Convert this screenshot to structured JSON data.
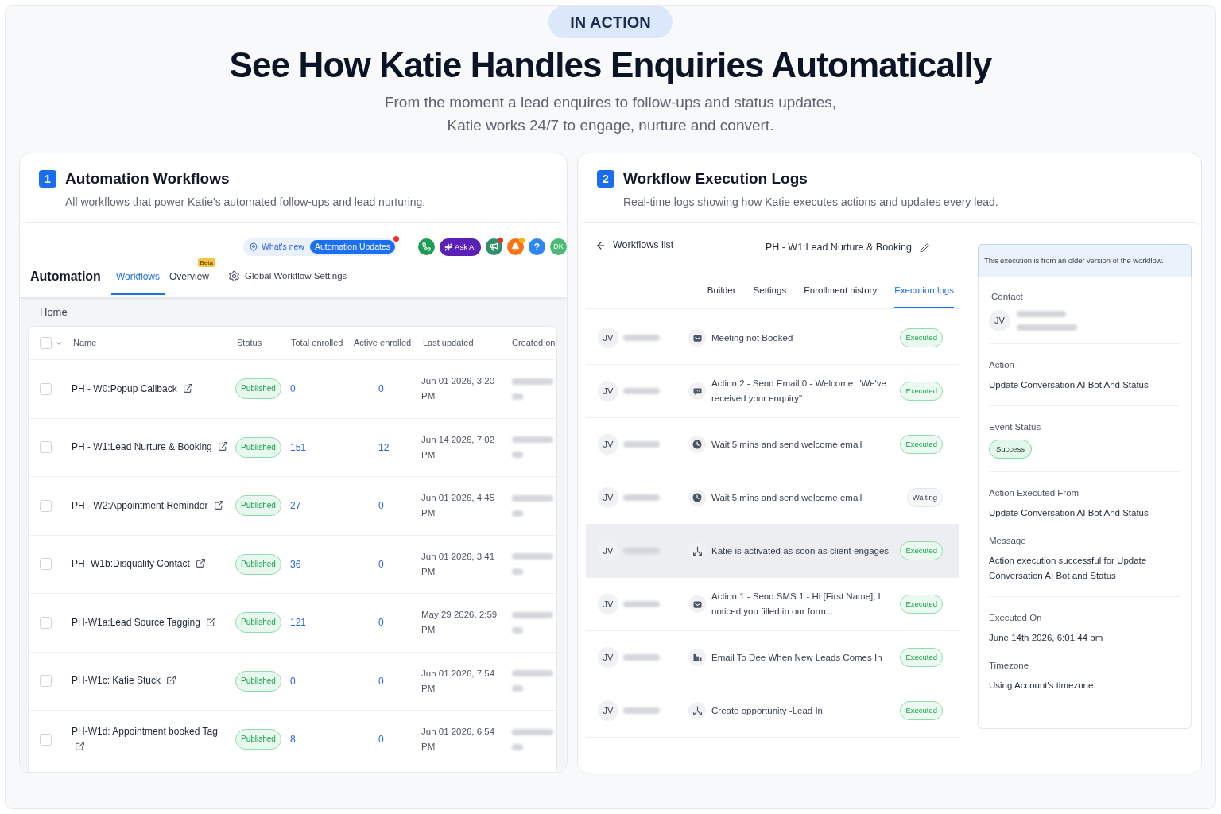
{
  "hero": {
    "badge": "IN ACTION",
    "title": "See How Katie Handles Enquiries Automatically",
    "subtitle_lines": [
      "From the moment a lead enquires to follow-ups and status updates,",
      "Katie works 24/7 to engage, nurture and convert."
    ]
  },
  "workflows_card": {
    "number": "1",
    "title": "Automation Workflows",
    "description": "All workflows that power Katie's automated follow-ups and lead nurturing.",
    "toolbar": {
      "whats_new": "What's new",
      "update_tag": "Automation Updates",
      "update_alert": true,
      "buttons": [
        {
          "kind": "phone",
          "alert": false
        },
        {
          "kind": "ask_ai",
          "label": "Ask AI"
        },
        {
          "kind": "megaphone",
          "alert": true
        },
        {
          "kind": "bell",
          "alert": true
        },
        {
          "kind": "help",
          "label": "?"
        },
        {
          "kind": "avatar",
          "label": "DK"
        }
      ]
    },
    "app_title": "Automation",
    "tabs": [
      {
        "label": "Workflows",
        "selected": true
      },
      {
        "label": "Overview",
        "selected": false,
        "badge": "Beta"
      }
    ],
    "settings_link": "Global Workflow Settings",
    "breadcrumb": "Home",
    "table": {
      "header_checked": false,
      "columns": [
        "Name",
        "Status",
        "Total enrolled",
        "Active enrolled",
        "Last updated",
        "Created on"
      ],
      "rows": [
        {
          "checked": false,
          "name": "PH - W0:Popup Callback",
          "status": "Published",
          "total_enrolled": "0",
          "active_enrolled": "0",
          "last_updated": "Jun 01 2026, 3:20 PM"
        },
        {
          "checked": false,
          "name": "PH - W1:Lead Nurture & Booking",
          "status": "Published",
          "total_enrolled": "151",
          "active_enrolled": "12",
          "last_updated": "Jun 14 2026, 7:02 PM"
        },
        {
          "checked": false,
          "name": "PH - W2:Appointment Reminder",
          "status": "Published",
          "total_enrolled": "27",
          "active_enrolled": "0",
          "last_updated": "Jun 01 2026, 4:45 PM"
        },
        {
          "checked": false,
          "name": "PH- W1b:Disqualify Contact",
          "status": "Published",
          "total_enrolled": "36",
          "active_enrolled": "0",
          "last_updated": "Jun 01 2026, 3:41 PM"
        },
        {
          "checked": false,
          "name": "PH-W1a:Lead Source Tagging",
          "status": "Published",
          "total_enrolled": "121",
          "active_enrolled": "0",
          "last_updated": "May 29 2026, 2:59 PM"
        },
        {
          "checked": false,
          "name": "PH-W1c: Katie Stuck",
          "status": "Published",
          "total_enrolled": "0",
          "active_enrolled": "0",
          "last_updated": "Jun 01 2026, 7:54 PM"
        },
        {
          "checked": false,
          "name": "PH-W1d: Appointment booked Tag",
          "status": "Published",
          "total_enrolled": "8",
          "active_enrolled": "0",
          "last_updated": "Jun 01 2026, 6:54 PM"
        }
      ]
    }
  },
  "logs_card": {
    "number": "2",
    "title": "Workflow Execution Logs",
    "description": "Real-time logs showing how Katie executes actions and updates every lead.",
    "back_link": "Workflows list",
    "workflow_name": "PH - W1:Lead Nurture & Booking",
    "tabs": [
      {
        "label": "Builder",
        "selected": false
      },
      {
        "label": "Settings",
        "selected": false
      },
      {
        "label": "Enrollment history",
        "selected": false
      },
      {
        "label": "Execution logs",
        "selected": true
      }
    ],
    "logs": [
      {
        "avatar": "JV",
        "kind": "email",
        "action": "Meeting not Booked",
        "status": "Executed",
        "pending": false,
        "selected": false
      },
      {
        "avatar": "JV",
        "kind": "message",
        "action": "Action 2 - Send Email 0 - Welcome: \"We've received your enquiry\"",
        "status": "Executed",
        "pending": false,
        "selected": false
      },
      {
        "avatar": "JV",
        "kind": "wait",
        "action": "Wait 5 mins and send welcome email",
        "status": "Executed",
        "pending": false,
        "selected": false
      },
      {
        "avatar": "JV",
        "kind": "wait",
        "action": "Wait 5 mins and send welcome email",
        "status": "Waiting",
        "pending": true,
        "selected": false
      },
      {
        "avatar": "JV",
        "kind": "split",
        "action": "Katie is activated as soon as client engages",
        "status": "Executed",
        "pending": false,
        "selected": true
      },
      {
        "avatar": "JV",
        "kind": "email",
        "action": "Action 1 - Send SMS 1 - Hi [First Name], I noticed you filled in our form...",
        "status": "Executed",
        "pending": false,
        "selected": false
      },
      {
        "avatar": "JV",
        "kind": "stats",
        "action": "Email To Dee When New Leads Comes In",
        "status": "Executed",
        "pending": false,
        "selected": false
      },
      {
        "avatar": "JV",
        "kind": "split",
        "action": "Create opportunity -Lead In",
        "status": "Executed",
        "pending": false,
        "selected": false
      }
    ],
    "details": {
      "notice": "This execution is from an older version of the workflow.",
      "contact_label": "Contact",
      "contact_avatar": "JV",
      "sections": [
        [
          {
            "kind": "text",
            "label": "Action",
            "value": "Update Conversation AI Bot And Status"
          }
        ],
        [
          {
            "kind": "badge",
            "label": "Event Status",
            "value": "Success"
          }
        ],
        [
          {
            "kind": "text",
            "label": "Action Executed From",
            "value": "Update Conversation AI Bot And Status"
          },
          {
            "kind": "text",
            "label": "Message",
            "value": "Action execution successful for Update Conversation AI Bot and Status"
          }
        ],
        [
          {
            "kind": "text",
            "label": "Executed On",
            "value": "June 14th 2026, 6:01:44 pm"
          },
          {
            "kind": "text",
            "label": "Timezone",
            "value": "Using Account's timezone."
          }
        ]
      ]
    }
  }
}
